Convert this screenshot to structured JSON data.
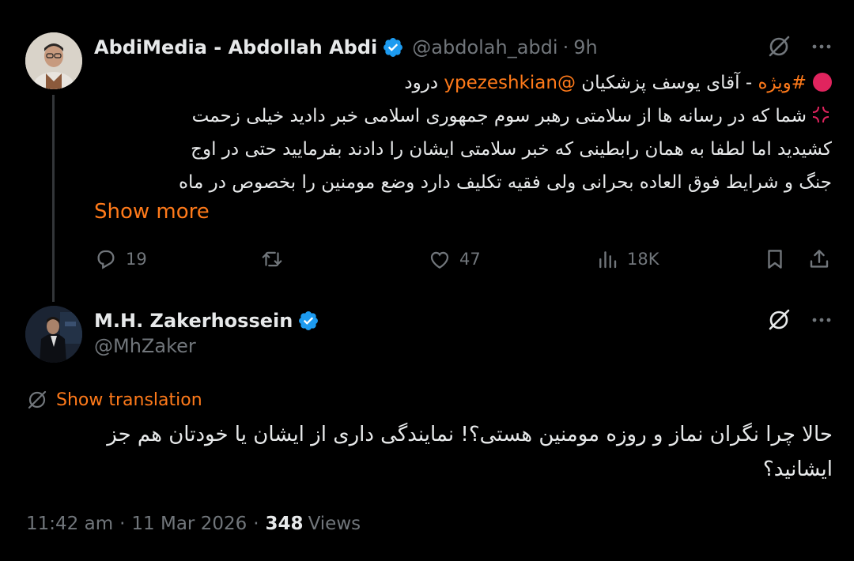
{
  "parent": {
    "name": "AbdiMedia - Abdollah Abdi",
    "handle": "@abdolah_abdi",
    "separator": "·",
    "time": "9h",
    "text_lines": {
      "line1": {
        "hashtag": "#ویژه",
        "part1": " - آقای یوسف پزشکیان ",
        "mention": "@ypezeshkian",
        "part2": " درود"
      },
      "line2": "شما که در رسانه ها از سلامتی رهبر سوم جمهوری اسلامی خبر دادید خیلی زحمت",
      "line3": "کشیدید اما لطفا به همان رابطینی که خبر سلامتی ایشان را دادند بفرمایید حتی در اوج",
      "line4": "جنگ و شرایط فوق العاده بحرانی ولی فقیه تکلیف دارد وضع مومنین را بخصوص در ماه"
    },
    "show_more": "Show more",
    "actions": {
      "replies": "19",
      "retweets": "",
      "likes": "47",
      "views": "18K"
    }
  },
  "reply": {
    "name": "M.H. Zakerhossein",
    "handle": "@MhZaker",
    "show_translation": "Show translation",
    "text_lines": {
      "line1": "حالا چرا نگران نماز و روزه مومنین هستی؟! نمایندگی داری از ایشان یا خودتان هم جز",
      "line2": "ایشانید؟"
    },
    "meta": {
      "time": "11:42 am",
      "date": "11 Mar 2026",
      "separator": "·",
      "views_count": "348",
      "views_label": "Views"
    }
  },
  "colors": {
    "background": "#000000",
    "text": "#e7e9ea",
    "muted": "#71767b",
    "accent": "#ff7a1a",
    "verified": "#1d9bf0"
  },
  "icons": {
    "verified": "verified-badge-icon",
    "grok": "grok-icon",
    "more": "more-icon",
    "reply": "reply-icon",
    "retweet": "retweet-icon",
    "like": "like-icon",
    "views": "views-icon",
    "bookmark": "bookmark-icon",
    "share": "share-icon",
    "translate": "translate-icon"
  }
}
